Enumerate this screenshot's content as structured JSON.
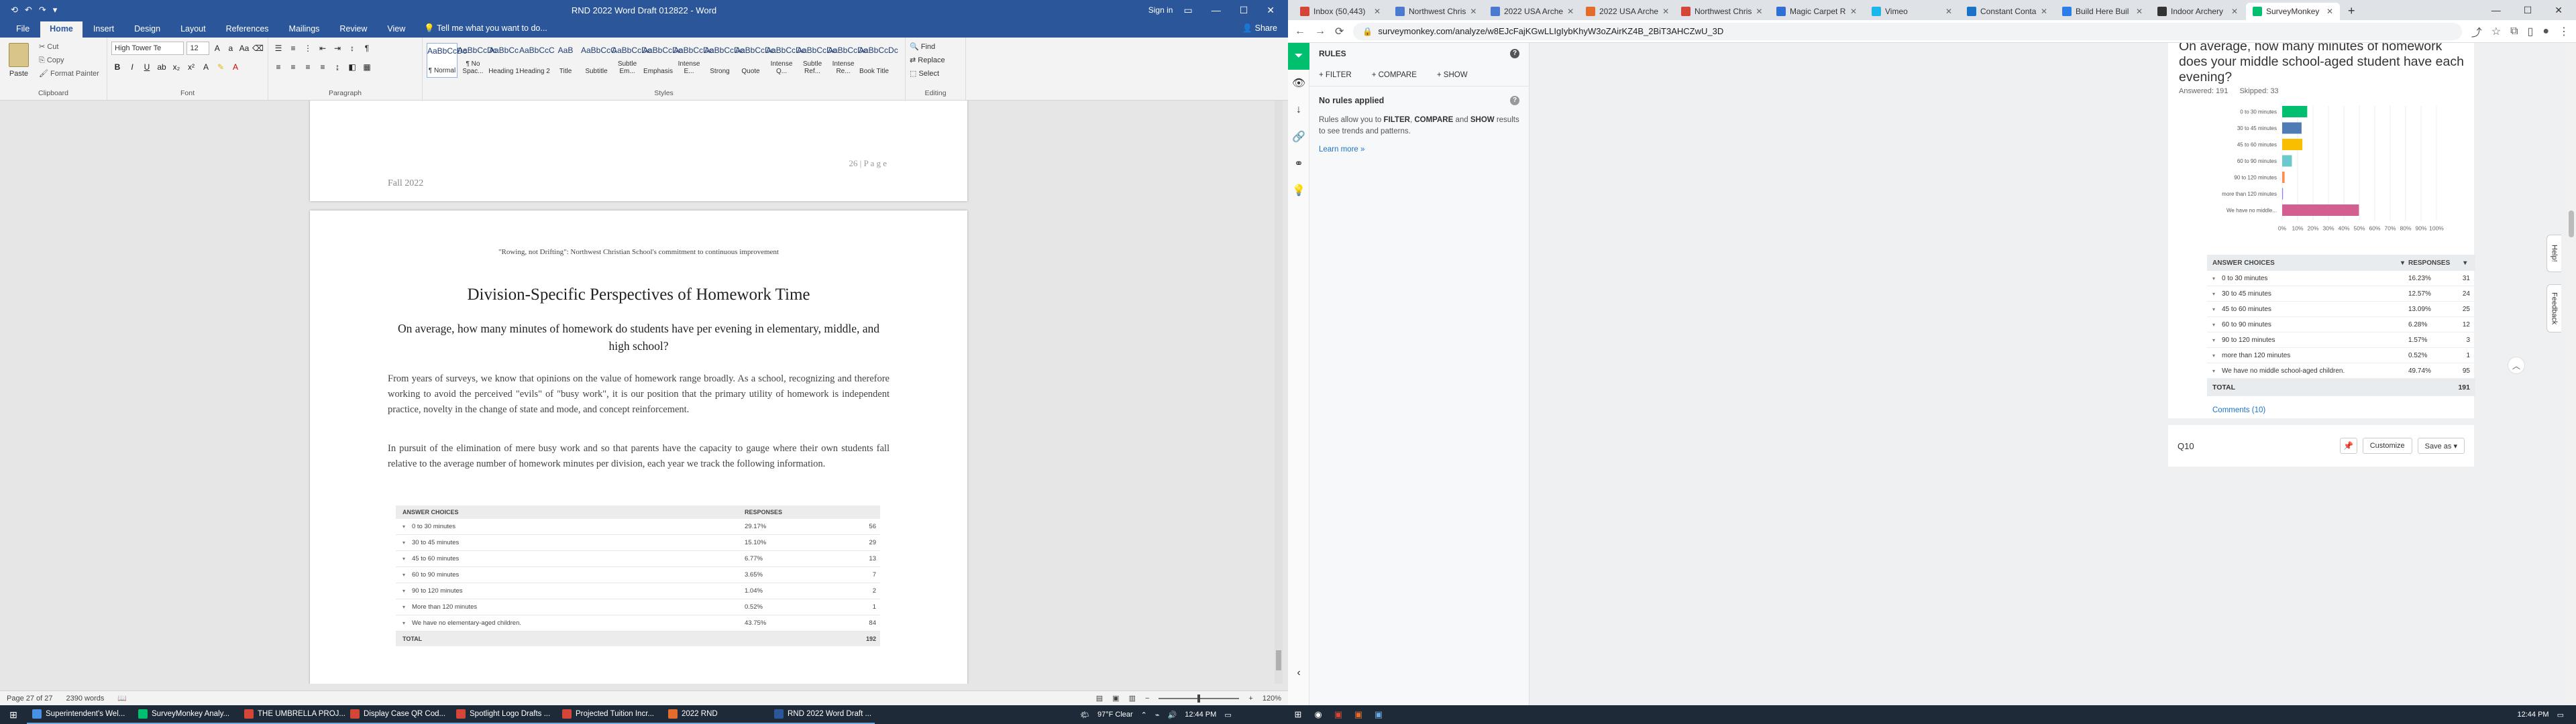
{
  "word": {
    "qat": [
      "⟲",
      "↶",
      "↷",
      "▾"
    ],
    "title": "RND 2022 Word Draft 012822 - Word",
    "user_sign_in": "Sign in",
    "share": "Share",
    "tabs": [
      "File",
      "Home",
      "Insert",
      "Design",
      "Layout",
      "References",
      "Mailings",
      "Review",
      "View"
    ],
    "active_tab": "Home",
    "tell_me": "Tell me what you want to do...",
    "clipboard": {
      "paste": "Paste",
      "cut": "Cut",
      "copy": "Copy",
      "format_painter": "Format Painter",
      "label": "Clipboard"
    },
    "font": {
      "name": "High Tower Te",
      "size": "12",
      "label": "Font"
    },
    "paragraph_label": "Paragraph",
    "styles_label": "Styles",
    "styles": [
      {
        "preview": "AaBbCcDc",
        "name": "¶ Normal"
      },
      {
        "preview": "AaBbCcDc",
        "name": "¶ No Spac..."
      },
      {
        "preview": "AaBbCc",
        "name": "Heading 1"
      },
      {
        "preview": "AaBbCcC",
        "name": "Heading 2"
      },
      {
        "preview": "AaB",
        "name": "Title"
      },
      {
        "preview": "AaBbCcC",
        "name": "Subtitle"
      },
      {
        "preview": "AaBbCcDc",
        "name": "Subtle Em..."
      },
      {
        "preview": "AaBbCcDc",
        "name": "Emphasis"
      },
      {
        "preview": "AaBbCcDc",
        "name": "Intense E..."
      },
      {
        "preview": "AaBbCcDc",
        "name": "Strong"
      },
      {
        "preview": "AaBbCcDc",
        "name": "Quote"
      },
      {
        "preview": "AaBbCcDc",
        "name": "Intense Q..."
      },
      {
        "preview": "AaBbCcDc",
        "name": "Subtle Ref..."
      },
      {
        "preview": "AaBbCcDc",
        "name": "Intense Re..."
      },
      {
        "preview": "AaBbCcDc",
        "name": "Book Title"
      }
    ],
    "editing": {
      "find": "Find",
      "replace": "Replace",
      "select": "Select",
      "label": "Editing"
    },
    "page1": {
      "footer_left": "Fall 2022",
      "footer_right": "26 | P a g e"
    },
    "page2": {
      "header": "\"Rowing, not Drifting\": Northwest Christian School's commitment to continuous improvement",
      "heading": "Division-Specific Perspectives of Homework Time",
      "subheading": "On average, how many minutes of homework do students have per evening in elementary, middle, and high school?",
      "para1": "From years of surveys, we know that opinions on the value of homework range broadly.  As a school, recognizing and therefore working to avoid the perceived \"evils\" of \"busy work\", it is our position that the primary utility of homework is independent practice, novelty in the change of state and mode, and concept reinforcement.",
      "para2": "In pursuit of the elimination of mere busy work and so that parents have the capacity to gauge where their own students fall relative to the average number of homework minutes per division, each year we track the following information.",
      "table_head": {
        "choices": "ANSWER CHOICES",
        "responses": "RESPONSES"
      },
      "table_rows": [
        {
          "choice": "0 to 30 minutes",
          "pct": "29.17%",
          "n": "56"
        },
        {
          "choice": "30 to 45 minutes",
          "pct": "15.10%",
          "n": "29"
        },
        {
          "choice": "45 to 60 minutes",
          "pct": "6.77%",
          "n": "13"
        },
        {
          "choice": "60 to 90 minutes",
          "pct": "3.65%",
          "n": "7"
        },
        {
          "choice": "90 to 120 minutes",
          "pct": "1.04%",
          "n": "2"
        },
        {
          "choice": "More than 120 minutes",
          "pct": "0.52%",
          "n": "1"
        },
        {
          "choice": "We have no elementary-aged children.",
          "pct": "43.75%",
          "n": "84"
        }
      ],
      "table_total": {
        "label": "TOTAL",
        "n": "192"
      }
    },
    "status": {
      "page": "Page 27 of 27",
      "words": "2390 words",
      "zoom": "120%"
    }
  },
  "browser": {
    "tabs": [
      {
        "title": "Inbox (50,443)",
        "color": "#d44638"
      },
      {
        "title": "Northwest Chris",
        "color": "#4a7bd0"
      },
      {
        "title": "2022 USA Arche",
        "color": "#4a7bd0"
      },
      {
        "title": "2022 USA Arche",
        "color": "#e36c2c"
      },
      {
        "title": "Northwest Chris",
        "color": "#d44638"
      },
      {
        "title": "Magic Carpet R",
        "color": "#2f6fd6"
      },
      {
        "title": "Vimeo",
        "color": "#1ab7ea"
      },
      {
        "title": "Constant Conta",
        "color": "#1a73c8"
      },
      {
        "title": "Build Here Buil",
        "color": "#2b7de9"
      },
      {
        "title": "Indoor Archery",
        "color": "#333333"
      },
      {
        "title": "SurveyMonkey",
        "color": "#00bf6f"
      }
    ],
    "active_tab": 10,
    "url": "surveymonkey.com/analyze/w8EJcFajKGwLLIgIybKhyW3oZAirKZ4B_2BiT3AHCZwU_3D",
    "rules": {
      "title": "RULES",
      "filter": "+ FILTER",
      "compare": "+ COMPARE",
      "show": "+ SHOW",
      "no_rules": "No rules applied",
      "desc_pre": "Rules allow you to ",
      "desc_filter": "FILTER",
      "desc_mid1": ", ",
      "desc_compare": "COMPARE",
      "desc_mid2": " and ",
      "desc_show": "SHOW",
      "desc_post": " results to see trends and patterns.",
      "learn_more": "Learn more »"
    },
    "question": {
      "title": "On average, how many minutes of homework does your middle school-aged student have each evening?",
      "answered": "Answered: 191",
      "skipped": "Skipped: 33"
    },
    "table_head": {
      "choices": "ANSWER CHOICES",
      "responses": "RESPONSES"
    },
    "table_rows": [
      {
        "choice": "0 to 30 minutes",
        "pct": "16.23%",
        "n": "31"
      },
      {
        "choice": "30 to 45 minutes",
        "pct": "12.57%",
        "n": "24"
      },
      {
        "choice": "45 to 60 minutes",
        "pct": "13.09%",
        "n": "25"
      },
      {
        "choice": "60 to 90 minutes",
        "pct": "6.28%",
        "n": "12"
      },
      {
        "choice": "90 to 120 minutes",
        "pct": "1.57%",
        "n": "3"
      },
      {
        "choice": "more than 120 minutes",
        "pct": "0.52%",
        "n": "1"
      },
      {
        "choice": "We have no middle school-aged children.",
        "pct": "49.74%",
        "n": "95"
      }
    ],
    "table_total": {
      "label": "TOTAL",
      "n": "191"
    },
    "comments": "Comments (10)",
    "next_q": "Q10",
    "customize": "Customize",
    "save_as": "Save as ▾",
    "help_tab": "Help!",
    "feedback_tab": "Feedback"
  },
  "chart_data": {
    "type": "bar",
    "orientation": "horizontal",
    "categories": [
      "0 to 30 minutes",
      "30 to 45 minutes",
      "45 to 60 minutes",
      "60 to 90 minutes",
      "90 to 120 minutes",
      "more than 120 minutes",
      "We have no middle..."
    ],
    "values": [
      16.23,
      12.57,
      13.09,
      6.28,
      1.57,
      0.52,
      49.74
    ],
    "colors": [
      "#00bf6f",
      "#507cb6",
      "#f9be00",
      "#6bc8cd",
      "#ff8b4f",
      "#7f7fff",
      "#d25f90"
    ],
    "xticks": [
      "0%",
      "10%",
      "20%",
      "30%",
      "40%",
      "50%",
      "60%",
      "70%",
      "80%",
      "90%",
      "100%"
    ],
    "xlim": [
      0,
      100
    ]
  },
  "taskbar": {
    "apps": [
      {
        "title": "Superintendent's Wel...",
        "color": "#4a90e2"
      },
      {
        "title": "SurveyMonkey Analy...",
        "color": "#00bf6f"
      },
      {
        "title": "THE UMBRELLA PROJ...",
        "color": "#d44638"
      },
      {
        "title": "Display Case QR Cod...",
        "color": "#d44638"
      },
      {
        "title": "Spotlight Logo Drafts ...",
        "color": "#d44638"
      },
      {
        "title": "Projected Tuition Incr...",
        "color": "#d44638"
      },
      {
        "title": "2022 RND",
        "color": "#e36c2c"
      },
      {
        "title": "RND 2022 Word Draft ...",
        "color": "#2b579a"
      }
    ],
    "weather": "97°F  Clear",
    "time": "12:44 PM",
    "time2": "12:44 PM"
  }
}
